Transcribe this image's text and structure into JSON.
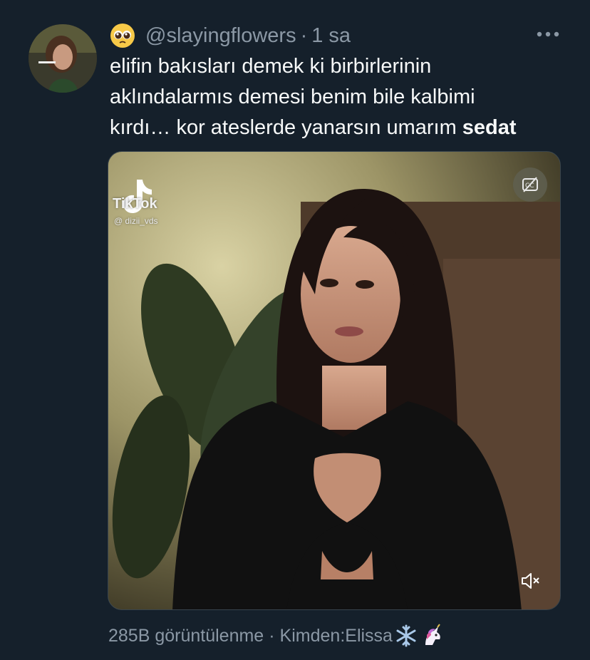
{
  "tweet": {
    "author_emoji": "pleading-face-emoji",
    "handle": "@slayingflowers",
    "separator": "·",
    "time": "1 sa",
    "text_lines": [
      "elifin bakısları demek ki birbirlerinin",
      "aklındalarmıs demesi benim bile kalbimi",
      "kırdı… kor ateslerde yanarsın umarım "
    ],
    "text_bold": "sedat",
    "more_icon": "more-horizontal-icon"
  },
  "media": {
    "watermark_brand": "TikTok",
    "watermark_handle": "@ dizii_vds",
    "cc_icon": "closed-captions-off-icon",
    "mute_icon": "speaker-muted-icon"
  },
  "footer": {
    "views": "285B görüntülenme",
    "separator": "·",
    "source_prefix": "Kimden: ",
    "source_name": "Elissa",
    "source_emojis": [
      "snowflake-emoji",
      "unicorn-emoji"
    ]
  },
  "colors": {
    "background": "#15202b",
    "text": "#f7f9f9",
    "muted": "#8b98a5",
    "border": "#38444d"
  }
}
